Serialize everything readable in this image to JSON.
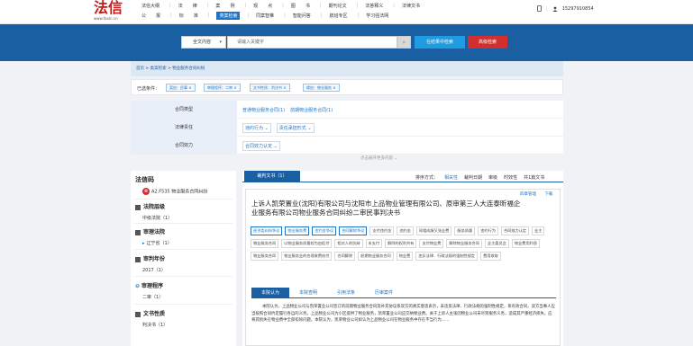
{
  "header": {
    "logo_text": "法信",
    "logo_url": "www.faxin.cn",
    "nav_row1": [
      "法信大纲",
      "|",
      "法",
      "律",
      "|",
      "案",
      "例",
      "|",
      "观",
      "点",
      "|",
      "图",
      "书",
      "|",
      "期刊论文",
      "|",
      "法答释义",
      "|",
      "法律文书"
    ],
    "nav_row2": [
      "公",
      "报",
      "|",
      "标",
      "准",
      "|",
      "类案检索",
      "|",
      "同案智推",
      "|",
      "智能问答",
      "|",
      "航班专区",
      "|",
      "学习强法网"
    ],
    "active_nav": "类案检索",
    "phone": "15297910854"
  },
  "search": {
    "type_label": "全文内容",
    "placeholder": "请输入关键字",
    "search_within_label": "在结果中检索",
    "advanced_label": "高级检索"
  },
  "breadcrumb": {
    "home": "首页",
    "sep": " > ",
    "level1": "类案检索",
    "level2": "物业服务合同纠纷"
  },
  "chosen": {
    "label": "已选条件：",
    "chips": [
      "案由：民事 ✕",
      "审理程序：二审 ✕",
      "文书性质：判决书 ✕",
      "缘由：物业服务 ✕"
    ]
  },
  "filters": [
    {
      "label": "合同类型",
      "values": [
        "普通物业服务合同(1)",
        "前期物业服务合同(1)"
      ],
      "style": "plain"
    },
    {
      "label": "法律责任",
      "values": [
        "违约行为 ⌄",
        "责任承担形式 ⌄"
      ],
      "style": "boxed"
    },
    {
      "label": "合同效力",
      "values": [
        "合同效力认定 ⌄"
      ],
      "style": "boxed"
    }
  ],
  "expand_label": "点击展开更多内容 ⌄",
  "sidebar": {
    "title": "法信码",
    "code": "A2.F535 物业服务合同纠纷",
    "sections": [
      {
        "title": "法院层级",
        "items": [
          "中级法院（1）"
        ]
      },
      {
        "title": "审理法院",
        "items": [
          "辽宁省（1）"
        ]
      },
      {
        "title": "审判年份",
        "items": [
          "2017（1）"
        ]
      },
      {
        "title": "审理程序",
        "items": [
          "二审（1）"
        ]
      },
      {
        "title": "文书性质",
        "items": [
          "判决书（1）"
        ]
      }
    ]
  },
  "results": {
    "tab_label": "裁判文书（1）",
    "sort_label": "排序方式：",
    "sort_options": [
      "相关性",
      "裁判日期",
      "审级",
      "时效性"
    ],
    "count_prefix": "共",
    "count": "1",
    "count_suffix": "篇文书"
  },
  "document": {
    "actions": [
      "四章管理",
      "下载"
    ],
    "title": "上诉人凯荣置业(沈阳)有限公司与沈阳市上品物业管理有限公司、原审第三人大连泰昕福企业服务有限公司物业服务合同纠纷二审民事判决书",
    "tags": [
      "经济类纠纷争议",
      "物业服务费",
      "违约金争议",
      "合同解除争议",
      "支付违约金",
      "违约金",
      "同相成服又张业费",
      "服务质量",
      "违约行为",
      "合同效力认定",
      "业主",
      "物业服务合同",
      "以物业服务质量较为由拒付",
      "相对人的抗辩",
      "未支付",
      "解除的权利共有",
      "支付物业费",
      "解除物业服务合同",
      "业主委员会",
      "物业费用利息",
      "物业服务合同",
      "物业服务业的合理收费给付",
      "合同解除",
      "前期物业服务合同",
      "物业费",
      "违反法律、行政法规的强制性规定",
      "费用收取"
    ],
    "highlight_tags": [
      0,
      1,
      2,
      3
    ],
    "tabs": [
      "本院认为",
      "本院查明",
      "引用法条",
      "历审案件"
    ],
    "body": "本院认为，上品物业公司与凯荣置业公司签订的前期物业服务合同及补充协议系双方的真实意思表示，未违反法律、行政法规的强制性规定，系有效合同，双方当事人应当按照合同约定履行各自的义务。上品物业公司为小区提供了物业服务，凯荣置业公司应交纳物业费。关于上诉人主张因物业公司未尽到服务义务，造成其严重经济损失，应将其损失在物业费中全部扣除问题，本院认为，凯荣物业公司如认为上品物业公司在物业服务中存在不当行为……"
  }
}
